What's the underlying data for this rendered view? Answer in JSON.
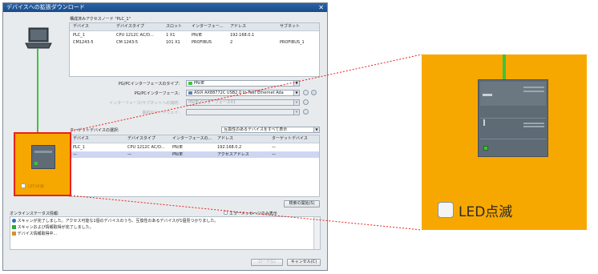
{
  "dialog": {
    "title": "デバイスへの拡張ダウンロード",
    "close_glyph": "✕",
    "config_label": "構成済みアクセスノード \"PLC_1\"",
    "config_table": {
      "headers": [
        "デバイス",
        "デバイスタイプ",
        "スロット",
        "インターフェー...",
        "アドレス",
        "サブネット"
      ],
      "rows": [
        [
          "PLC_1",
          "CPU 1212C AC/D...",
          "1 X1",
          "PN/IE",
          "192.168.0.1",
          ""
        ],
        [
          "CM1243-5",
          "CM 1243-5",
          "101 X1",
          "PROFIBUS",
          "2",
          "PROFIBUS_1"
        ]
      ]
    },
    "pg_pc_type_label": "PG/PCインターフェースのタイプ:",
    "pg_pc_type_value": "PN/IE",
    "pg_pc_if_label": "PG/PCインターフェース:",
    "pg_pc_if_value": "ASIX AX88772C USB2.0 to Fast Ethernet Ada",
    "subnet_conn_label": "インターフェース/サブネットへの接続:",
    "subnet_conn_value": "PN/IEインターフェースX1",
    "gateway_label": "最初のゲートウェイ:",
    "gateway_value": "",
    "target_label": "ターゲットデバイスの選択:",
    "target_filter": "互換性のあるデバイスをすべて表示",
    "target_table": {
      "headers": [
        "デバイス",
        "デバイスタイプ",
        "インターフェースの...",
        "アドレス",
        "ターゲットデバイス"
      ],
      "rows": [
        [
          "PLC_1",
          "CPU 1212C AC/D...",
          "PN/IE",
          "192.168.0.2",
          "—"
        ],
        [
          "—",
          "—",
          "PN/IE",
          "アクセスアドレス",
          "—"
        ]
      ]
    },
    "led_label": "LED点滅",
    "start_search": "検索の開始(S)",
    "status_label": "オンラインステータス情報:",
    "error_only": "エラーメッセージのみ表示",
    "messages": [
      {
        "icon": "info-icon",
        "text": "スキャンが完了しました。アクセス可能な1個のデバイスのうち、互換性のあるデバイスが1個見つかりました。"
      },
      {
        "icon": "check-icon",
        "text": "スキャンおよび情報取得が完了しました。"
      },
      {
        "icon": "network-icon",
        "text": "デバイス情報取得中..."
      }
    ],
    "load_button": "ロード(L)",
    "cancel_button": "キャンセル(C)"
  },
  "zoom": {
    "led_label": "LED点滅"
  },
  "colors": {
    "accent_orange": "#f7a800",
    "highlight_red": "#e8221a",
    "connection_green": "#3bc43b",
    "title_blue": "#1f5699"
  }
}
